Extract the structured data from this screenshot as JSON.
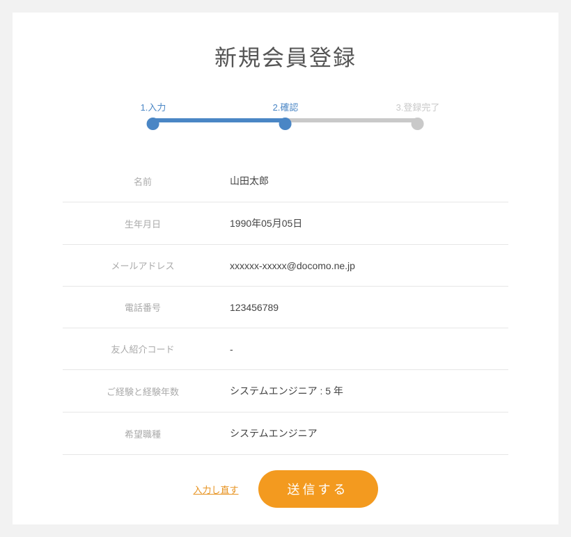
{
  "title": "新規会員登録",
  "steps": {
    "s1": "1.入力",
    "s2": "2.確認",
    "s3": "3.登録完了"
  },
  "fields": [
    {
      "label": "名前",
      "value": "山田太郎"
    },
    {
      "label": "生年月日",
      "value": "1990年05月05日"
    },
    {
      "label": "メールアドレス",
      "value": "xxxxxx-xxxxx@docomo.ne.jp"
    },
    {
      "label": "電話番号",
      "value": "123456789"
    },
    {
      "label": "友人紹介コード",
      "value": "-"
    },
    {
      "label": "ご経験と経験年数",
      "value": "システムエンジニア : 5 年"
    },
    {
      "label": "希望職種",
      "value": "システムエンジニア"
    }
  ],
  "actions": {
    "back": "入力し直す",
    "submit": "送信する"
  }
}
